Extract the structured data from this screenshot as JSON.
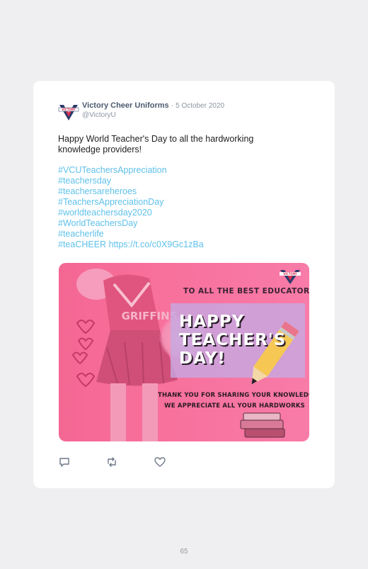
{
  "tweet": {
    "author_name": "Victory Cheer Uniforms",
    "separator": "·",
    "date": "5 October 2020",
    "handle": "@VictoryU",
    "text": "Happy World Teacher's Day to all the hardworking knowledge providers!",
    "hashtags": [
      "#VCUTeachersAppreciation",
      "#teachersday",
      "#teachersareheroes",
      "#TeachersAppreciationDay",
      "#worldteachersday2020",
      "#WorldTeachersDay",
      "#teacherlife"
    ],
    "last_hashtag": "#teaCHEER",
    "link": "https://t.co/c0X9Gc1zBa"
  },
  "media": {
    "logo_text": "VICTORY",
    "uniform_text": "GRIFFINS",
    "to_all": "TO ALL THE BEST EDUCATORS,",
    "title_line1": "HAPPY",
    "title_line2": "TEACHER'S",
    "title_line3": "DAY!",
    "thanks_line1": "THANK YOU FOR SHARING YOUR KNOWLEDGE!",
    "thanks_line2": "WE APPRECIATE ALL YOUR HARDWORKS"
  },
  "actions": {
    "reply_icon": "reply-icon",
    "retweet_icon": "retweet-icon",
    "like_icon": "heart-icon"
  },
  "colors": {
    "hashtag": "#5ec0ea",
    "author": "#4b5b6f",
    "media_pink": "#f46794",
    "title_box": "#c4aae4"
  },
  "page_number": "65"
}
